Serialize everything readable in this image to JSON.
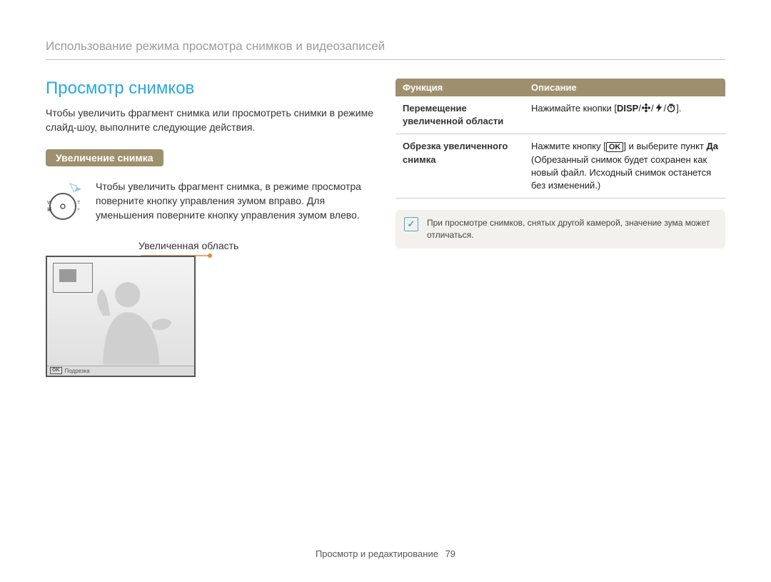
{
  "breadcrumb": "Использование режима просмотра снимков и видеозаписей",
  "section_title": "Просмотр снимков",
  "intro": "Чтобы увеличить фрагмент снимка или просмотреть снимки в режиме слайд-шоу, выполните следующие действия.",
  "pill": "Увеличение снимка",
  "zoom_text": "Чтобы увеличить фрагмент снимка, в режиме просмотра поверните кнопку управления зумом вправо. Для уменьшения поверните кнопку управления зумом влево.",
  "enlarged_label": "Увеличенная область",
  "screen_bar": {
    "ok": "OK",
    "label": "Подрезка"
  },
  "zoom_dial": {
    "left": "W",
    "left2": "◫",
    "center": "○",
    "right": "T",
    "right2": "🔍"
  },
  "table": {
    "head": {
      "fn": "Функция",
      "desc": "Описание"
    },
    "rows": [
      {
        "fn": "Перемещение увеличенной области",
        "desc_prefix": "Нажимайте кнопки [",
        "desc_disp": "DISP",
        "desc_sep": "/",
        "desc_suffix": "]."
      },
      {
        "fn": "Обрезка увеличенного снимка",
        "desc_prefix": "Нажмите кнопку [",
        "desc_ok": "OK",
        "desc_mid": "] и выберите пункт ",
        "desc_bold": "Да",
        "desc_tail": " (Обрезанный снимок будет сохранен как новый файл. Исходный снимок останется без изменений.)"
      }
    ]
  },
  "note": "При просмотре снимков, снятых другой камерой, значение зума может отличаться.",
  "footer": {
    "section": "Просмотр и редактирование",
    "page": "79"
  },
  "icons": {
    "flower": "flower-icon",
    "flash": "flash-icon",
    "timer": "timer-icon"
  }
}
